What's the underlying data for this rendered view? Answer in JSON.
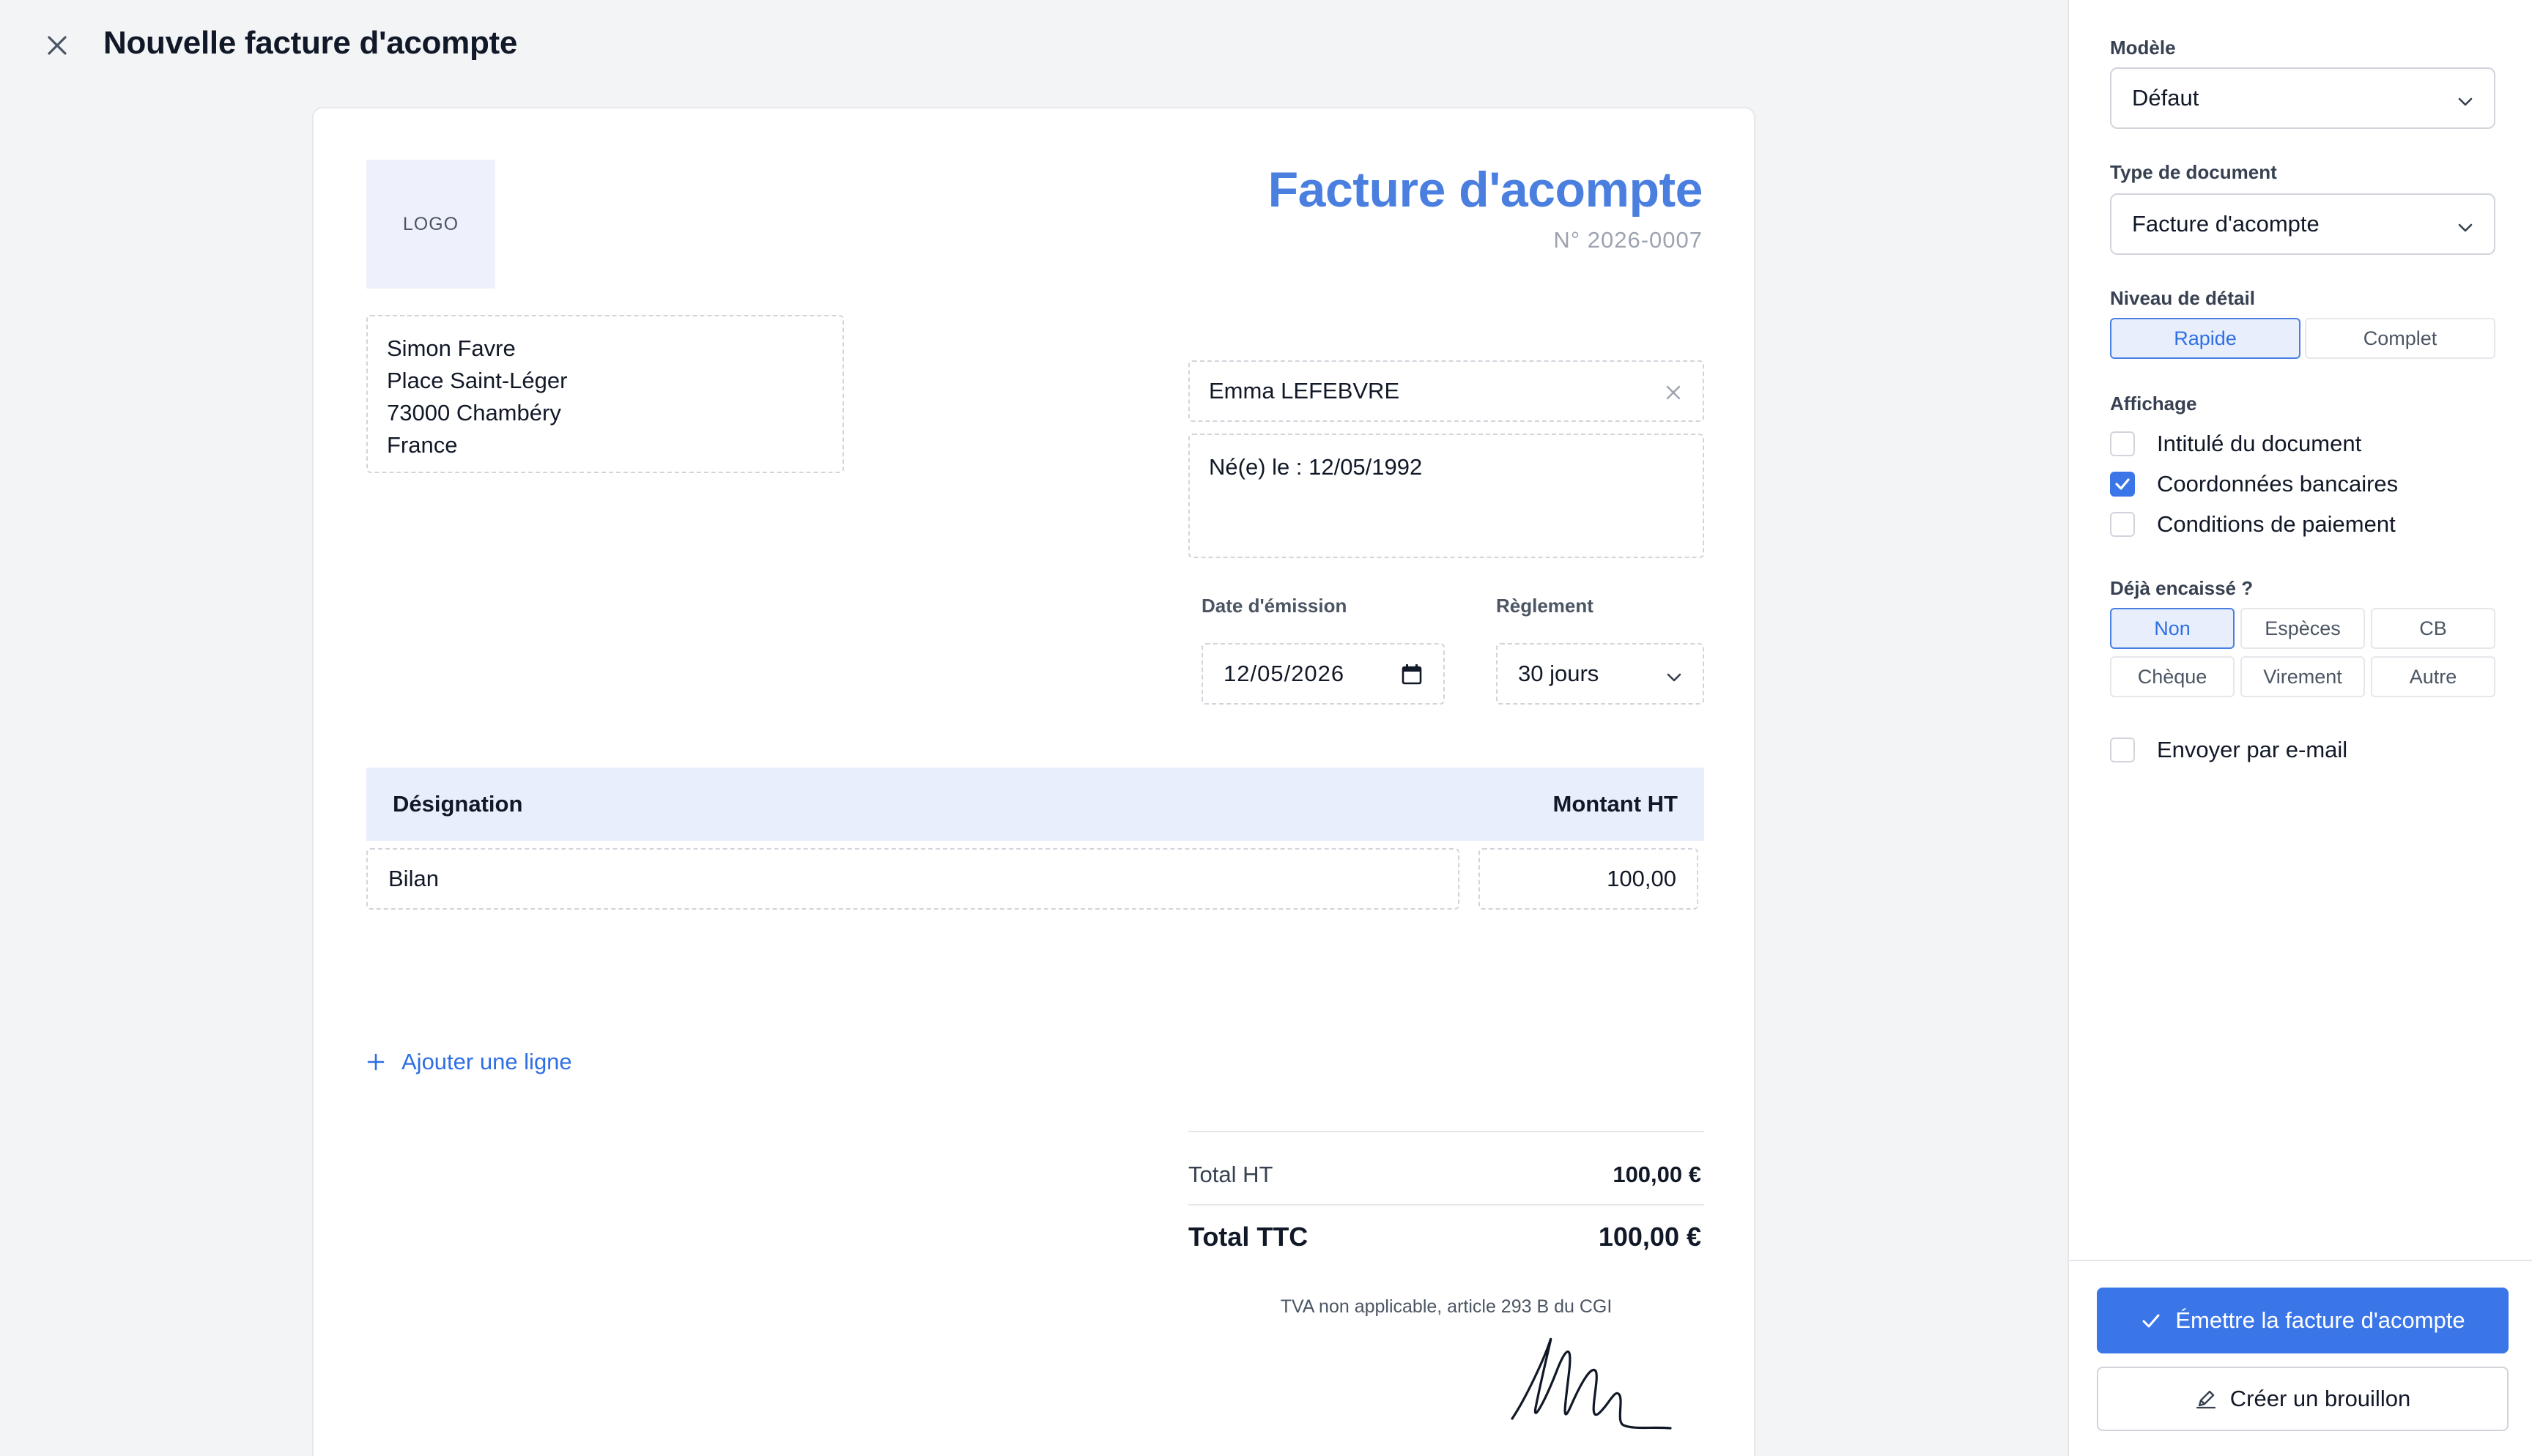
{
  "header": {
    "title": "Nouvelle facture d'acompte"
  },
  "document": {
    "logo_text": "LOGO",
    "heading": "Facture d'acompte",
    "number": "N° 2026-0007",
    "sender": {
      "lines": [
        "Simon Favre",
        "Place Saint-Léger",
        "73000 Chambéry",
        "France"
      ]
    },
    "client": {
      "name": "Emma LEFEBVRE",
      "notes": "Né(e) le : 12/05/1992"
    },
    "issue_date": {
      "label": "Date d'émission",
      "value": "12/05/2026"
    },
    "payment_terms": {
      "label": "Règlement",
      "value": "30 jours"
    },
    "table": {
      "headers": {
        "designation": "Désignation",
        "amount": "Montant HT"
      },
      "rows": [
        {
          "designation": "Bilan",
          "amount": "100,00"
        }
      ],
      "add_line": "Ajouter une ligne"
    },
    "totals": {
      "ht_label": "Total HT",
      "ht_value": "100,00 €",
      "ttc_label": "Total TTC",
      "ttc_value": "100,00 €"
    },
    "vat_note": "TVA non applicable, article 293 B du CGI"
  },
  "panel": {
    "model": {
      "label": "Modèle",
      "value": "Défaut"
    },
    "doc_type": {
      "label": "Type de document",
      "value": "Facture d'acompte"
    },
    "detail": {
      "label": "Niveau de détail",
      "options": [
        "Rapide",
        "Complet"
      ],
      "selected": "Rapide"
    },
    "display": {
      "label": "Affichage",
      "options": [
        {
          "label": "Intitulé du document",
          "checked": false
        },
        {
          "label": "Coordonnées bancaires",
          "checked": true
        },
        {
          "label": "Conditions de paiement",
          "checked": false
        }
      ]
    },
    "paid": {
      "label": "Déjà encaissé ?",
      "options": [
        "Non",
        "Espèces",
        "CB",
        "Chèque",
        "Virement",
        "Autre"
      ],
      "selected": "Non"
    },
    "email": {
      "label": "Envoyer par e-mail",
      "checked": false
    },
    "primary_action": "Émettre la facture d'acompte",
    "secondary_action": "Créer un brouillon"
  },
  "colors": {
    "accent": "#3b76e8",
    "heading": "#4a7fe0",
    "table_header_bg": "#e8eefc"
  }
}
